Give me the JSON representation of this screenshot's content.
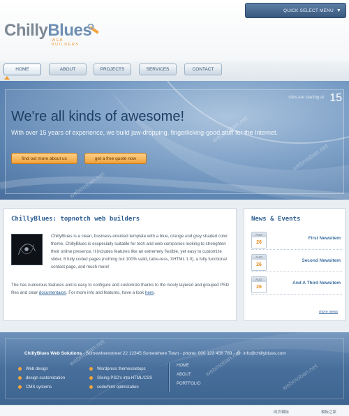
{
  "header": {
    "quick_select": "QUICK SELECT MENU",
    "quick_arrow": "▼",
    "logo_name_1": "Chilly",
    "logo_name_2": "Blues",
    "logo_sub": "WEB BUILDERS"
  },
  "nav": {
    "items": [
      {
        "label": "HOME"
      },
      {
        "label": "ABOUT"
      },
      {
        "label": "PROJECTS"
      },
      {
        "label": "SERVICES"
      },
      {
        "label": "CONTACT"
      }
    ]
  },
  "hero": {
    "headline": "We're all kinds of awesome!",
    "tagline": "With over 15 years of experience, we build jaw-dropping, fingerlicking-good stuff for the Internet.",
    "starting_text": "sites are starting at",
    "price": "15",
    "btn_about": "find out more about us",
    "btn_quote": "get a free quote now"
  },
  "main": {
    "title": "ChillyBlues: topnotch web builders",
    "para1": "ChillyBlues is a clean, business-oriented template with a blue, orange and grey shaded color theme. ChillyBlues is escpecially suitable for tech and web companies looking to strenghten their online presence. It includes features like an extremely flexible, yet easy to customize slider, 8 fully coded pages (nothing but 100% valid, table-less, XHTML 1.0), a fully functional contact page, and much more!",
    "para2_a": "The has numerous features and is easy to configure and customize thanks to the nicely layered and grouped PSD files and clear ",
    "para2_link1": "documentaion",
    "para2_b": ". For more info and features, have a look ",
    "para2_link2": "here",
    "para2_c": "."
  },
  "news": {
    "title": "News & Events",
    "items": [
      {
        "month": "AUG",
        "day": "26",
        "label": "First Newsitem"
      },
      {
        "month": "AUG",
        "day": "26",
        "label": "Second Newsitem"
      },
      {
        "month": "AUG",
        "day": "26",
        "label": "And A Third Newsitem"
      }
    ],
    "more": "more news"
  },
  "footer": {
    "company": "ChillyBlues Web Solutions",
    "address": " - Somewherestreet 22 12345 Somewhere Town - phone: 000 123 456 789 - @: info@chillyblues.com",
    "col1": [
      "Web design",
      "design customization",
      "CMS systems"
    ],
    "col2": [
      "Wordpress themes/setups",
      "Slicing PSD's into HTML/CSS",
      "code/html optimization"
    ],
    "links": [
      "HOME",
      "ABOUT",
      "PORTFOLIO"
    ]
  },
  "bottom": {
    "left_text": "网页模板",
    "right_text": "模板之家"
  },
  "watermark": "webmoban.net",
  "colors": {
    "accent": "#f19a2f",
    "brand_blue": "#2e5f91",
    "hero_blue": "#6f94bd"
  }
}
